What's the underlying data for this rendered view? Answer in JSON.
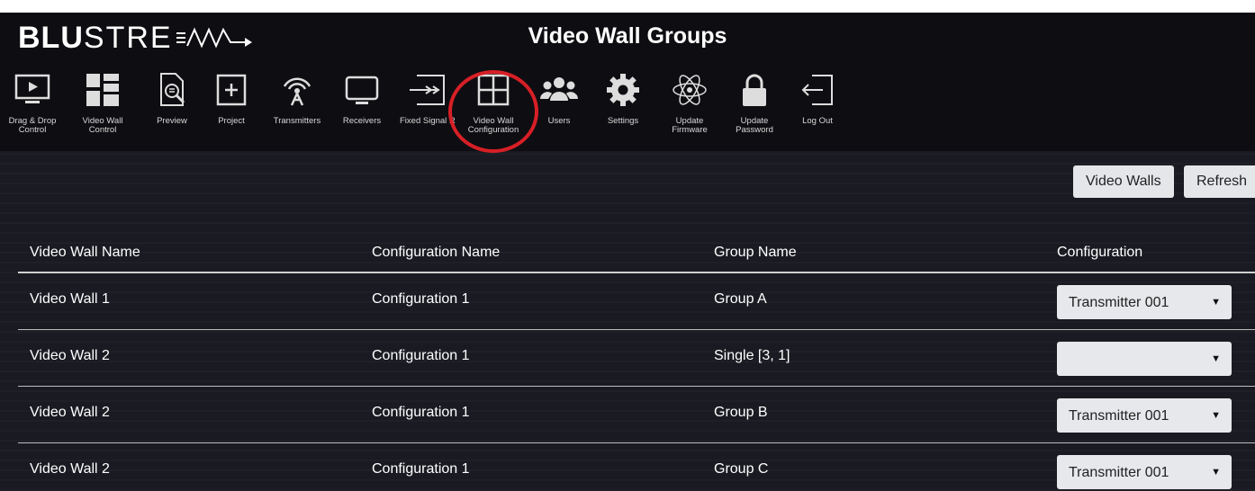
{
  "app": {
    "logo_text_bold": "BLU",
    "logo_text_thin": "STRE",
    "title": "Video Wall Groups",
    "accent_color": "#d81f26"
  },
  "toolbar": {
    "items": [
      {
        "label": "Drag & Drop Control",
        "icon": "monitor-play-icon"
      },
      {
        "label": "Video Wall Control",
        "icon": "video-wall-grid-icon"
      },
      {
        "label": "Preview",
        "icon": "preview-document-icon"
      },
      {
        "label": "Project",
        "icon": "project-plus-icon"
      },
      {
        "label": "Transmitters",
        "icon": "broadcast-tower-icon"
      },
      {
        "label": "Receivers",
        "icon": "tv-monitor-icon"
      },
      {
        "label": "Fixed Signal Routing",
        "icon": "routing-arrows-icon"
      },
      {
        "label": "Video Wall Configuration",
        "icon": "grid-config-icon"
      },
      {
        "label": "Users",
        "icon": "users-icon"
      },
      {
        "label": "Settings",
        "icon": "gear-icon"
      },
      {
        "label": "Update Firmware",
        "icon": "atom-icon"
      },
      {
        "label": "Update Password",
        "icon": "lock-icon"
      },
      {
        "label": "Log Out",
        "icon": "logout-icon"
      }
    ],
    "highlighted": "Video Wall Configuration"
  },
  "actions": {
    "video_walls_label": "Video Walls",
    "refresh_label": "Refresh"
  },
  "table": {
    "columns": [
      "Video Wall Name",
      "Configuration Name",
      "Group Name",
      "Configuration"
    ],
    "rows": [
      {
        "wall": "Video Wall 1",
        "config": "Configuration 1",
        "group": "Group A",
        "selected": "Transmitter 001"
      },
      {
        "wall": "Video Wall 2",
        "config": "Configuration 1",
        "group": "Single [3, 1]",
        "selected": ""
      },
      {
        "wall": "Video Wall 2",
        "config": "Configuration 1",
        "group": "Group B",
        "selected": "Transmitter 001"
      },
      {
        "wall": "Video Wall 2",
        "config": "Configuration 1",
        "group": "Group C",
        "selected": "Transmitter 001"
      }
    ]
  }
}
